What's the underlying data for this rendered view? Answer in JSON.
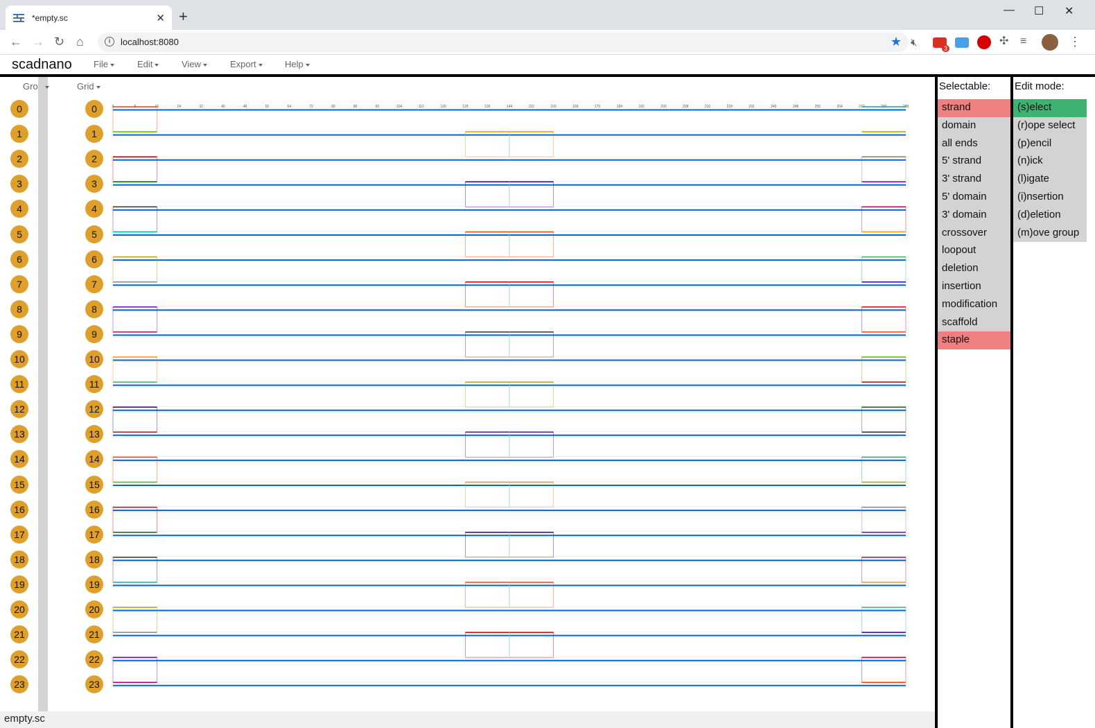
{
  "browser": {
    "tab_title": "*empty.sc",
    "url": "localhost:8080",
    "mail_badge": "3"
  },
  "app": {
    "brand": "scadnano",
    "menu": [
      "File",
      "Edit",
      "View",
      "Export",
      "Help"
    ],
    "side_dropdown_1": "Gro",
    "side_dropdown_2": "Grid",
    "status_file": "empty.sc"
  },
  "helices": [
    "0",
    "1",
    "2",
    "3",
    "4",
    "5",
    "6",
    "7",
    "8",
    "9",
    "10",
    "11",
    "12",
    "13",
    "14",
    "15",
    "16",
    "17",
    "18",
    "19",
    "20",
    "21",
    "22",
    "23"
  ],
  "ruler_ticks": [
    "0",
    "8",
    "16",
    "24",
    "32",
    "40",
    "48",
    "56",
    "64",
    "72",
    "80",
    "88",
    "96",
    "104",
    "112",
    "120",
    "128",
    "136",
    "144",
    "152",
    "160",
    "168",
    "176",
    "184",
    "192",
    "200",
    "208",
    "216",
    "224",
    "232",
    "240",
    "248",
    "256",
    "264",
    "272",
    "280",
    "288"
  ],
  "selectable": {
    "title": "Selectable:",
    "items": [
      {
        "label": "strand",
        "on": true
      },
      {
        "label": "domain",
        "on": false
      },
      {
        "label": "all ends",
        "on": false
      },
      {
        "label": "5' strand",
        "on": false
      },
      {
        "label": "3' strand",
        "on": false
      },
      {
        "label": "5' domain",
        "on": false
      },
      {
        "label": "3' domain",
        "on": false
      },
      {
        "label": "crossover",
        "on": false
      },
      {
        "label": "loopout",
        "on": false
      },
      {
        "label": "deletion",
        "on": false
      },
      {
        "label": "insertion",
        "on": false
      },
      {
        "label": "modification",
        "on": false
      },
      {
        "label": "scaffold",
        "on": false
      },
      {
        "label": "staple",
        "on": true
      }
    ]
  },
  "edit_mode": {
    "title": "Edit mode:",
    "items": [
      {
        "label": "(s)elect",
        "on": true
      },
      {
        "label": "(r)ope select",
        "on": false
      },
      {
        "label": "(p)encil",
        "on": false
      },
      {
        "label": "(n)ick",
        "on": false
      },
      {
        "label": "(l)igate",
        "on": false
      },
      {
        "label": "(i)nsertion",
        "on": false
      },
      {
        "label": "(d)eletion",
        "on": false
      },
      {
        "label": "(m)ove group",
        "on": false
      }
    ]
  },
  "colors": {
    "scaffold": "#0066cc",
    "helix_circle": "#dfa02b",
    "selected_red": "#f08080",
    "selected_green": "#3cb371",
    "staple_palette": [
      "#f74308",
      "#57bb00",
      "#cc0000",
      "#007200",
      "#333333",
      "#03b6a2",
      "#aaaa00",
      "#888888",
      "#7300de",
      "#b8056c",
      "#f7931e",
      "#32b86c",
      "#320096",
      "#e60026"
    ]
  }
}
